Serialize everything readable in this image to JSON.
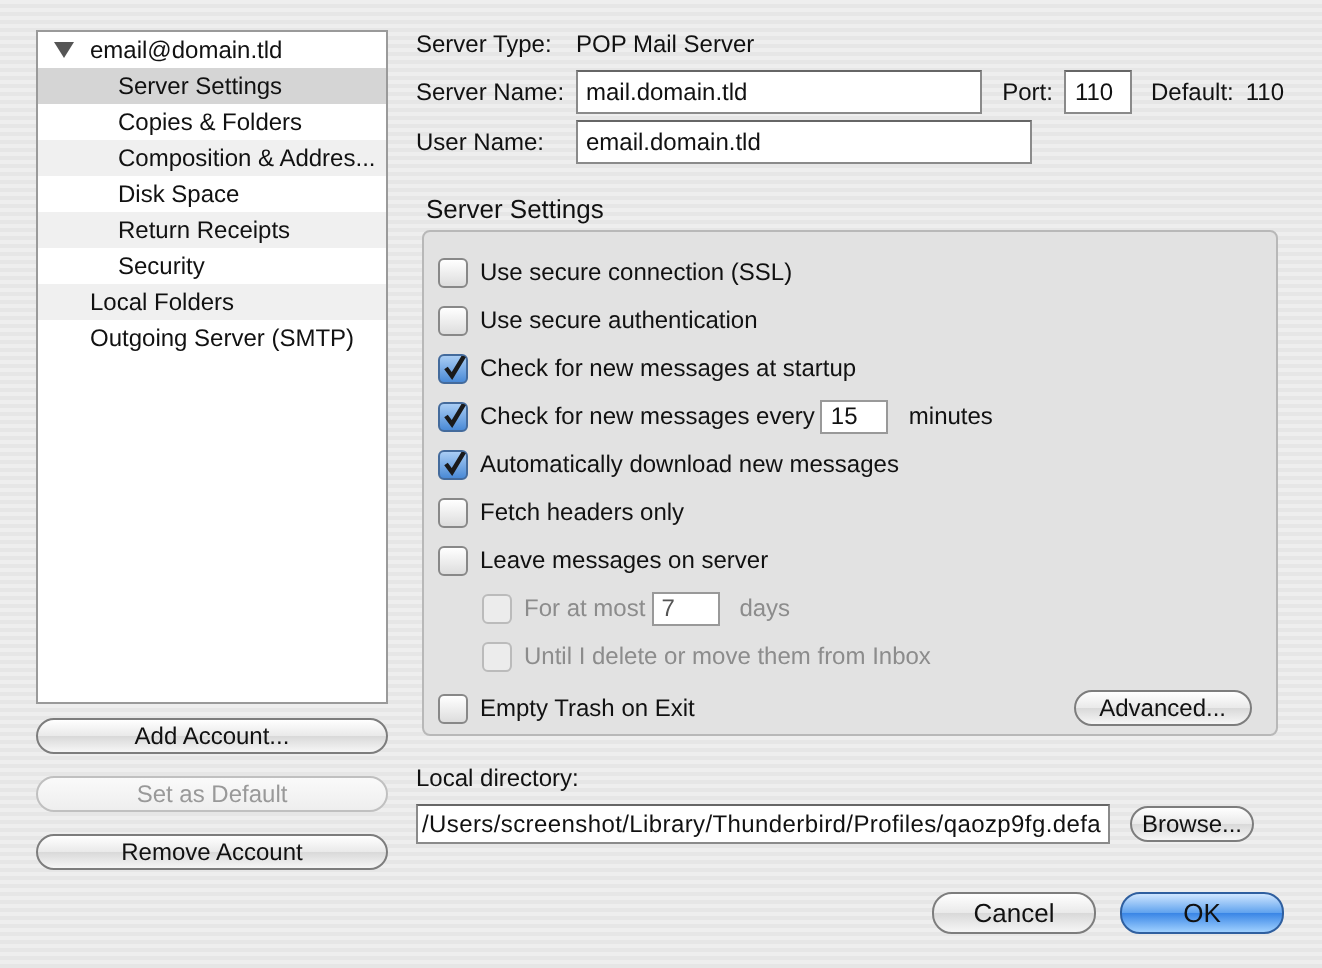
{
  "accounts": [
    {
      "label": "email@domain.tld",
      "expanded": true,
      "selected": false,
      "children": [
        {
          "label": "Server Settings",
          "selected": true
        },
        {
          "label": "Copies & Folders",
          "selected": false
        },
        {
          "label": "Composition & Addres...",
          "selected": false
        },
        {
          "label": "Disk Space",
          "selected": false
        },
        {
          "label": "Return Receipts",
          "selected": false
        },
        {
          "label": "Security",
          "selected": false
        }
      ]
    },
    {
      "label": "Local Folders",
      "selected": false
    },
    {
      "label": "Outgoing Server (SMTP)",
      "selected": false
    }
  ],
  "account_buttons": [
    {
      "label": "Add Account...",
      "disabled": false
    },
    {
      "label": "Set as Default",
      "disabled": true
    },
    {
      "label": "Remove Account",
      "disabled": false
    }
  ],
  "server_type": {
    "label": "Server Type:",
    "value": "POP Mail Server"
  },
  "server_name": {
    "label": "Server Name:",
    "value": "mail.domain.tld"
  },
  "port": {
    "label": "Port:",
    "value": "110"
  },
  "default_port": {
    "label": "Default:",
    "value": "110"
  },
  "user_name": {
    "label": "User Name:",
    "value": "email.domain.tld"
  },
  "group": {
    "title": "Server Settings",
    "options": [
      {
        "kind": "checkbox",
        "label": "Use secure connection (SSL)",
        "checked": false,
        "disabled": false
      },
      {
        "kind": "checkbox",
        "label": "Use secure authentication",
        "checked": false,
        "disabled": false
      },
      {
        "kind": "checkbox",
        "label": "Check for new messages at startup",
        "checked": true,
        "disabled": false
      },
      {
        "kind": "checkbox-number",
        "label": "Check for new messages every",
        "value": "15",
        "suffix": "minutes",
        "checked": true,
        "disabled": false
      },
      {
        "kind": "checkbox",
        "label": "Automatically download new messages",
        "checked": true,
        "disabled": false
      },
      {
        "kind": "checkbox",
        "label": "Fetch headers only",
        "checked": false,
        "disabled": false
      },
      {
        "kind": "checkbox",
        "label": "Leave messages on server",
        "checked": false,
        "disabled": false,
        "children": [
          {
            "kind": "checkbox-number",
            "label": "For at most",
            "value": "7",
            "suffix": "days",
            "checked": false,
            "disabled": true
          },
          {
            "kind": "checkbox",
            "label": "Until I delete or move them from Inbox",
            "checked": false,
            "disabled": true
          }
        ]
      }
    ],
    "footer_option": {
      "kind": "checkbox",
      "label": "Empty Trash on Exit",
      "checked": false,
      "disabled": false
    },
    "advanced_button": "Advanced..."
  },
  "local_directory": {
    "label": "Local directory:",
    "value": "/Users/screenshot/Library/Thunderbird/Profiles/qaozp9fg.defa",
    "button": "Browse..."
  },
  "dialog_buttons": [
    {
      "label": "Cancel",
      "kind": "cancel"
    },
    {
      "label": "OK",
      "kind": "default"
    }
  ]
}
